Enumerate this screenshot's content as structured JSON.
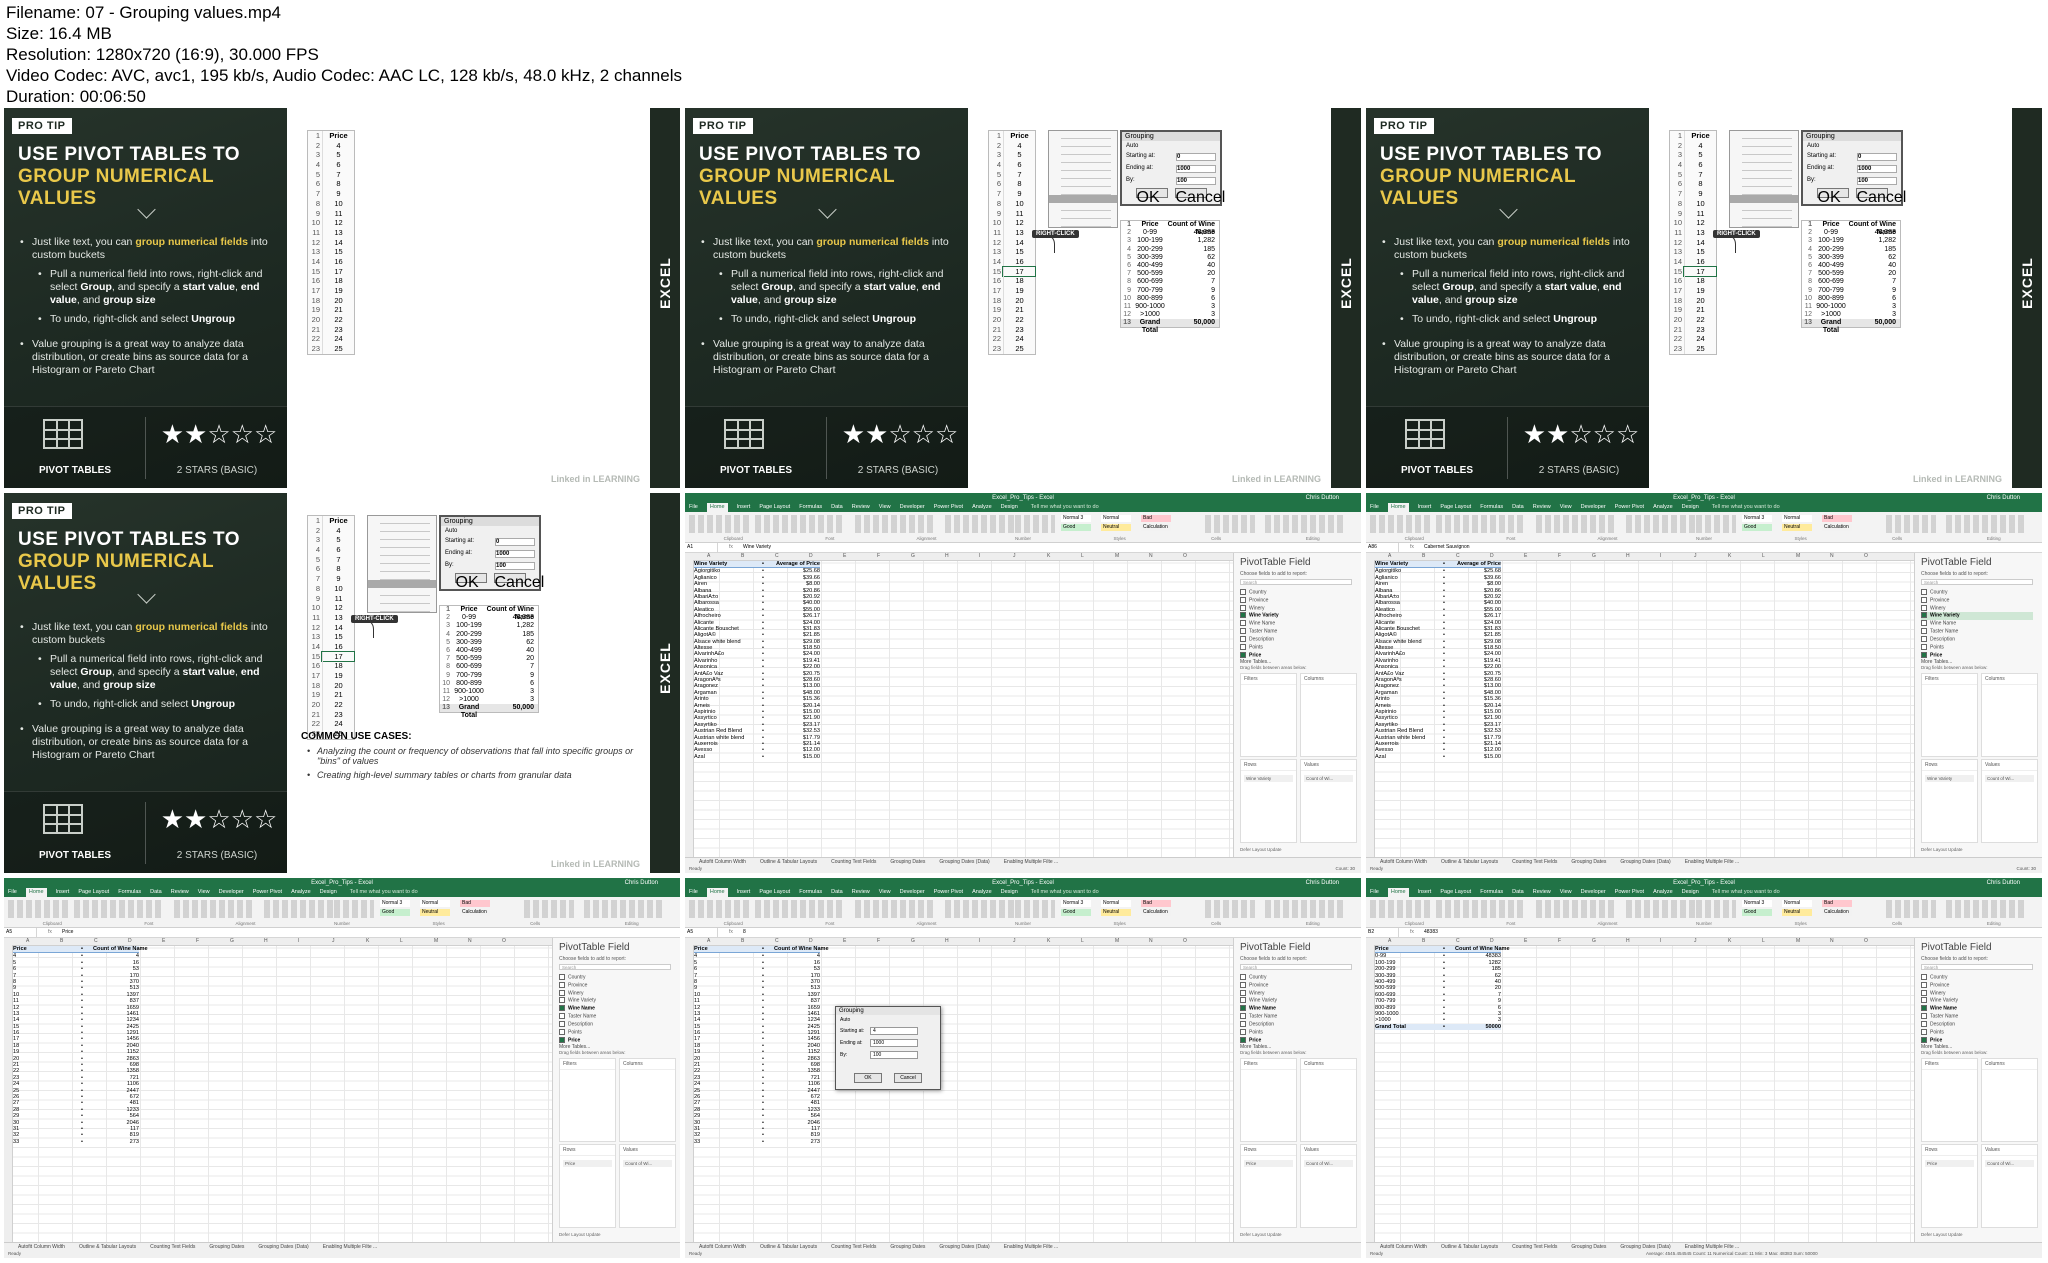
{
  "header": {
    "lines": [
      "Filename: 07 - Grouping values.mp4",
      "Size: 16.4 MB",
      "Resolution: 1280x720 (16:9), 30.000 FPS",
      "Video Codec: AVC, avc1, 195 kb/s, Audio Codec: AAC LC, 128 kb/s, 48.0 kHz, 2 channels",
      "Duration: 00:06:50"
    ]
  },
  "slide": {
    "tag": "PRO TIP",
    "title_line1": "USE PIVOT TABLES TO",
    "title_line2": "GROUP NUMERICAL VALUES",
    "bullet1_pre": "Just like text, you can ",
    "bullet1_hl": "group numerical fields",
    "bullet1_post": " into custom buckets",
    "sub1_pre": "Pull a numerical field into rows, right-click and select ",
    "sub1_group": "Group",
    "sub1_mid": ", and specify a ",
    "sub1_start": "start value",
    "sub1_end": "end value",
    "sub1_and": ", and ",
    "sub1_size": "group size",
    "sub2_pre": "To undo, right-click and select ",
    "sub2_ungroup": "Ungroup",
    "bullet2": "Value grouping is a great way to analyze data distribution, or create bins as source data for a Histogram or Pareto Chart",
    "footer_label1": "PIVOT TABLES",
    "stars": "★★☆☆☆",
    "footer_label2_main": "2 STARS",
    "footer_label2_sub": "(BASIC)",
    "brand": "EXCEL",
    "watermark": "Linked in LEARNING",
    "right_click_badge": "RIGHT-CLICK",
    "price_header": "Price",
    "price_list": [
      "4",
      "5",
      "6",
      "7",
      "8",
      "9",
      "10",
      "11",
      "12",
      "13",
      "14",
      "15",
      "16",
      "17",
      "18",
      "19",
      "20",
      "21",
      "22",
      "23",
      "24",
      "25"
    ],
    "dialog": {
      "title": "Grouping",
      "auto": "Auto",
      "starting": "Starting at:",
      "starting_val": "0",
      "ending": "Ending at:",
      "ending_val": "1000",
      "by": "By:",
      "by_val": "100",
      "ok": "OK",
      "cancel": "Cancel"
    },
    "result_headers": [
      "Price",
      "Count of Wine Name"
    ],
    "result_rows": [
      [
        "0-99",
        "48,383"
      ],
      [
        "100-199",
        "1,282"
      ],
      [
        "200-299",
        "185"
      ],
      [
        "300-399",
        "62"
      ],
      [
        "400-499",
        "40"
      ],
      [
        "500-599",
        "20"
      ],
      [
        "600-699",
        "7"
      ],
      [
        "700-799",
        "9"
      ],
      [
        "800-899",
        "6"
      ],
      [
        "900-1000",
        "3"
      ],
      [
        ">1000",
        "3"
      ]
    ],
    "result_total": [
      "Grand Total",
      "50,000"
    ],
    "use_cases_title": "COMMON USE CASES:",
    "use_case1": "Analyzing the count or frequency of observations that fall into specific groups or \"bins\" of values",
    "use_case2": "Creating high-level summary tables or charts from granular data"
  },
  "excel": {
    "title": "Excel_Pro_Tips - Excel",
    "tools": "PivotTable Tools",
    "user": "Chris Dutton",
    "tabs": [
      "File",
      "Home",
      "Insert",
      "Page Layout",
      "Formulas",
      "Data",
      "Review",
      "View",
      "Developer",
      "Power Pivot",
      "Analyze",
      "Design"
    ],
    "tell_me": "Tell me what you want to do",
    "share": "Share",
    "ribbon_groups": [
      "Clipboard",
      "Font",
      "Alignment",
      "Number",
      "Styles",
      "Cells",
      "Editing"
    ],
    "styles": [
      {
        "label": "Normal 3",
        "bg": "#ffffff"
      },
      {
        "label": "Normal",
        "bg": "#ffffff"
      },
      {
        "label": "Bad",
        "bg": "#ffc7ce"
      },
      {
        "label": "Good",
        "bg": "#c6efce"
      },
      {
        "label": "Neutral",
        "bg": "#ffeb9c"
      },
      {
        "label": "Calculation",
        "bg": "#f2f2f2"
      }
    ],
    "columns": [
      "A",
      "B",
      "C",
      "D",
      "E",
      "F",
      "G",
      "H",
      "I",
      "J",
      "K",
      "L",
      "M",
      "N",
      "O"
    ],
    "pane": {
      "title": "PivotTable Field",
      "subtitle": "Choose fields to add to report:",
      "search": "Search",
      "fields": [
        "Country",
        "Province",
        "Winery",
        "Wine Variety",
        "Wine Name",
        "Taster Name",
        "Description",
        "Points",
        "Price"
      ],
      "more": "More Tables...",
      "drag": "Drag fields between areas below:",
      "filters": "Filters",
      "columns": "Columns",
      "rows": "Rows",
      "values": "Values",
      "values_field": "Count of Wi...",
      "defer": "Defer Layout Update",
      "update": "Update"
    },
    "sheet_tabs": [
      "Autofit Column Width",
      "Outline & Tabular Layouts",
      "Counting Text Fields",
      "Grouping Dates",
      "Grouping Dates (Data)",
      "Enabling Multiple Filte ..."
    ],
    "status_ready": "Ready",
    "variety": {
      "cell_ref": "A1",
      "formula": "Wine Variety",
      "formula2": "Cabernet Sauvignon",
      "cell_ref2": "A86",
      "headers": [
        "Wine Variety",
        "Average of Price"
      ],
      "rows": [
        [
          "Agiorgitiko",
          "$25.68"
        ],
        [
          "Aglianico",
          "$39.66"
        ],
        [
          "Airen",
          "$8.00"
        ],
        [
          "Albana",
          "$20.86"
        ],
        [
          "AlbariÃ±o",
          "$20.92"
        ],
        [
          "Albarossa",
          "$40.00"
        ],
        [
          "Aleatico",
          "$55.00"
        ],
        [
          "Alfrocheiro",
          "$26.17"
        ],
        [
          "Alicante",
          "$24.00"
        ],
        [
          "Alicante Bouschet",
          "$31.83"
        ],
        [
          "AligotÃ©",
          "$21.85"
        ],
        [
          "Alsace white blend",
          "$29.08"
        ],
        [
          "Altesse",
          "$18.50"
        ],
        [
          "AlvarinhÃ£o",
          "$24.00"
        ],
        [
          "Alvarinho",
          "$19.41"
        ],
        [
          "Ansonica",
          "$22.00"
        ],
        [
          "AntÃ£o Vaz",
          "$20.75"
        ],
        [
          "AragonÃªs",
          "$28.60"
        ],
        [
          "Aragonez",
          "$13.00"
        ],
        [
          "Argaman",
          "$48.00"
        ],
        [
          "Arinto",
          "$15.36"
        ],
        [
          "Arneis",
          "$20.14"
        ],
        [
          "Aspirinio",
          "$15.00"
        ],
        [
          "Assyrtico",
          "$21.90"
        ],
        [
          "Assyrtiko",
          "$23.17"
        ],
        [
          "Austrian Red Blend",
          "$32.53"
        ],
        [
          "Austrian white blend",
          "$17.79"
        ],
        [
          "Auxerrois",
          "$21.14"
        ],
        [
          "Avesso",
          "$12.00"
        ],
        [
          "Azal",
          "$15.00"
        ]
      ],
      "status_right": "100%"
    },
    "price": {
      "cell_ref": "A5",
      "formula": "Price",
      "formula2": "8",
      "headers": [
        "Price",
        "Count of Wine Name"
      ],
      "rows": [
        [
          "4",
          "4"
        ],
        [
          "5",
          "16"
        ],
        [
          "6",
          "53"
        ],
        [
          "7",
          "170"
        ],
        [
          "8",
          "370"
        ],
        [
          "9",
          "513"
        ],
        [
          "10",
          "1397"
        ],
        [
          "11",
          "837"
        ],
        [
          "12",
          "1659"
        ],
        [
          "13",
          "1461"
        ],
        [
          "14",
          "1234"
        ],
        [
          "15",
          "2425"
        ],
        [
          "16",
          "1291"
        ],
        [
          "17",
          "1456"
        ],
        [
          "18",
          "2040"
        ],
        [
          "19",
          "1152"
        ],
        [
          "20",
          "2863"
        ],
        [
          "21",
          "698"
        ],
        [
          "22",
          "1358"
        ],
        [
          "23",
          "721"
        ],
        [
          "24",
          "1106"
        ],
        [
          "25",
          "2447"
        ],
        [
          "26",
          "672"
        ],
        [
          "27",
          "481"
        ],
        [
          "28",
          "1233"
        ],
        [
          "29",
          "564"
        ],
        [
          "30",
          "2046"
        ],
        [
          "31",
          "117"
        ],
        [
          "32",
          "819"
        ],
        [
          "33",
          "273"
        ]
      ],
      "dialog": {
        "title": "Grouping",
        "auto": "Auto",
        "starting": "Starting at:",
        "starting_val": "4",
        "ending": "Ending at:",
        "ending_val": "1000",
        "by": "By:",
        "by_val": "100",
        "ok": "OK",
        "cancel": "Cancel"
      }
    },
    "grouped": {
      "cell_ref": "B2",
      "formula": "48383",
      "headers": [
        "Price",
        "Count of Wine Name"
      ],
      "rows": [
        [
          "0-99",
          "48383"
        ],
        [
          "100-199",
          "1282"
        ],
        [
          "200-299",
          "185"
        ],
        [
          "300-399",
          "62"
        ],
        [
          "400-499",
          "40"
        ],
        [
          "500-599",
          "20"
        ],
        [
          "600-699",
          "7"
        ],
        [
          "700-799",
          "9"
        ],
        [
          "800-899",
          "6"
        ],
        [
          "900-1000",
          "3"
        ],
        [
          ">1000",
          "3"
        ]
      ],
      "total": [
        "Grand Total",
        "50000"
      ],
      "status_mid": "Average: 4545.454545    Count: 11    Numerical Count: 11    Min: 3    Max: 48383    Sum: 50000"
    },
    "frame5_status": "Count: 30"
  }
}
